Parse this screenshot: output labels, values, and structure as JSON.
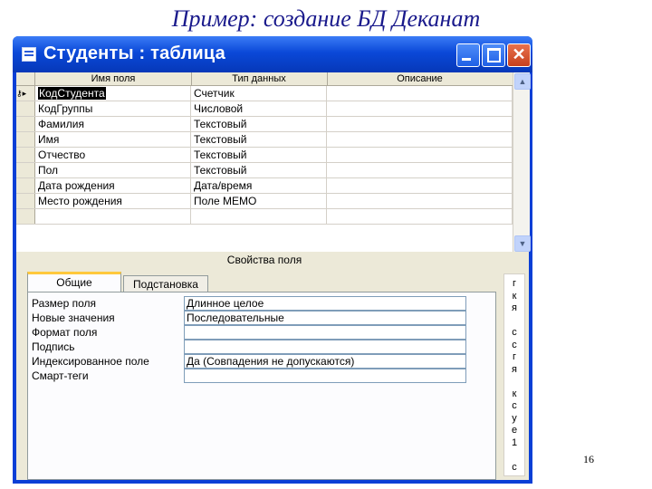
{
  "slide": {
    "title": "Пример: создание БД Деканат",
    "page_number": "16"
  },
  "window": {
    "title": "Студенты : таблица",
    "icon": "table-icon"
  },
  "grid": {
    "columns": [
      "Имя поля",
      "Тип данных",
      "Описание"
    ],
    "rows": [
      {
        "selector": "⚷▸",
        "name": "КодСтудента",
        "type": "Счетчик",
        "desc": "",
        "key": true
      },
      {
        "selector": "",
        "name": "КодГруппы",
        "type": "Числовой",
        "desc": ""
      },
      {
        "selector": "",
        "name": "Фамилия",
        "type": "Текстовый",
        "desc": ""
      },
      {
        "selector": "",
        "name": "Имя",
        "type": "Текстовый",
        "desc": ""
      },
      {
        "selector": "",
        "name": "Отчество",
        "type": "Текстовый",
        "desc": ""
      },
      {
        "selector": "",
        "name": "Пол",
        "type": "Текстовый",
        "desc": ""
      },
      {
        "selector": "",
        "name": "Дата рождения",
        "type": "Дата/время",
        "desc": ""
      },
      {
        "selector": "",
        "name": "Место рождения",
        "type": "Поле MEMO",
        "desc": ""
      },
      {
        "selector": "",
        "name": "",
        "type": "",
        "desc": ""
      }
    ]
  },
  "properties": {
    "header": "Свойства поля",
    "tabs": [
      "Общие",
      "Подстановка"
    ],
    "active_tab": "Общие",
    "fields": [
      {
        "label": "Размер поля",
        "value": "Длинное целое"
      },
      {
        "label": "Новые значения",
        "value": "Последовательные"
      },
      {
        "label": "Формат поля",
        "value": ""
      },
      {
        "label": "Подпись",
        "value": ""
      },
      {
        "label": "Индексированное поле",
        "value": "Да (Совпадения не допускаются)"
      },
      {
        "label": "Смарт-теги",
        "value": ""
      }
    ],
    "hint_chars": [
      "г",
      "к",
      "я",
      "",
      "с",
      "с",
      "г",
      "я",
      "",
      "к",
      "с",
      "у",
      "е",
      "1",
      "",
      "с"
    ]
  },
  "colors": {
    "titlebar": "#0a48d8",
    "slide_title": "#1a1a8c",
    "active_tab_accent": "#ffc83c"
  }
}
